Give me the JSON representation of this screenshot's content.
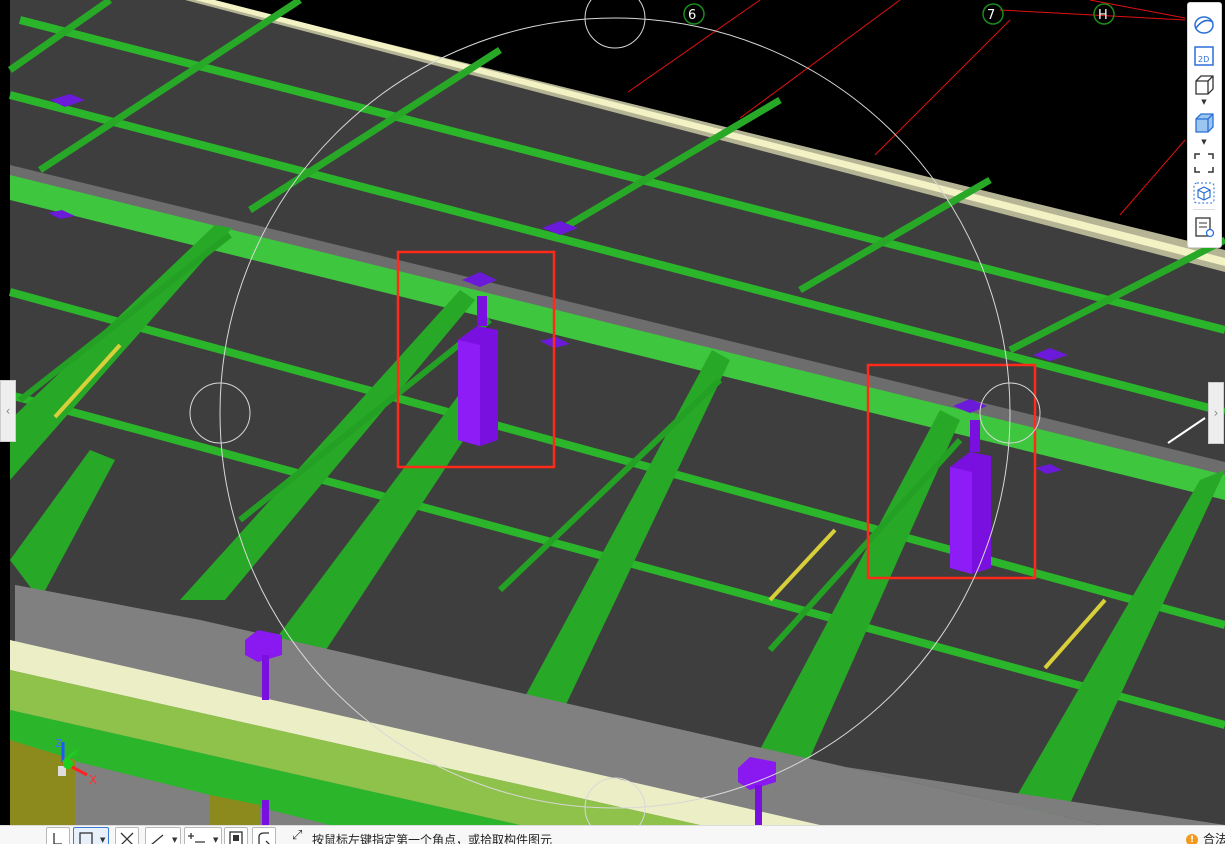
{
  "grid_labels": [
    "6",
    "7",
    "H"
  ],
  "axis_labels": {
    "z": "Z",
    "y": "Y",
    "x": "X"
  },
  "colors": {
    "beam": "#2fb52f",
    "beam_dark": "#1e8a1e",
    "slab": "#3c3c3c",
    "column": "#7a10e0",
    "highlight": "#ff2a1a",
    "wall": "#7a7a7a",
    "parapet": "#e8ecc8",
    "rebar": "#d9cf3a"
  },
  "view_toolbar": {
    "items": [
      "orbit-icon",
      "2d-view-icon",
      "wireframe-box-icon",
      "solid-box-icon",
      "zoom-extents-icon",
      "isometric-view-icon",
      "display-settings-icon"
    ],
    "label_2d": "2D"
  },
  "status_bar": {
    "tools": [
      "point-select-icon",
      "rectangle-select-icon",
      "cross-select-icon",
      "polyline-select-icon",
      "add-point-icon",
      "window-select-icon",
      "arc-select-icon"
    ],
    "prompt": "按鼠标左键指定第一个角点，或拾取构件图元",
    "right_text": "合法"
  }
}
